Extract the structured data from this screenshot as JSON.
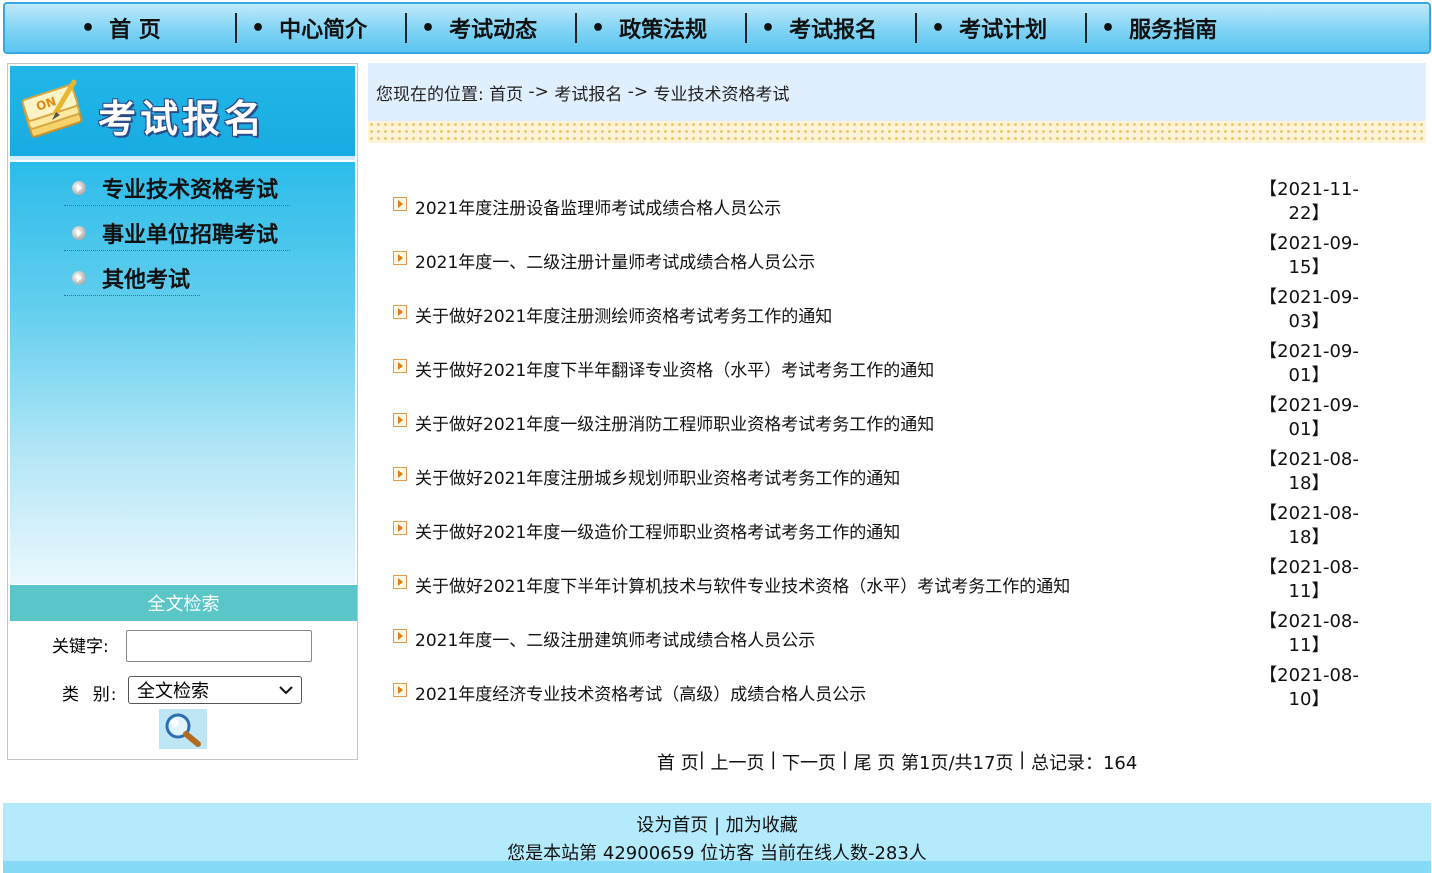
{
  "nav": {
    "items": [
      {
        "label": "首 页"
      },
      {
        "label": "中心简介"
      },
      {
        "label": "考试动态"
      },
      {
        "label": "政策法规"
      },
      {
        "label": "考试报名"
      },
      {
        "label": "考试计划"
      },
      {
        "label": "服务指南"
      }
    ],
    "bullet": "•"
  },
  "sidebar": {
    "banner_title": "考试报名",
    "items": [
      {
        "label": "专业技术资格考试"
      },
      {
        "label": "事业单位招聘考试"
      },
      {
        "label": "其他考试"
      }
    ],
    "search": {
      "heading": "全文检索",
      "keyword_label": "关键字:",
      "keyword_value": "",
      "category_label": "类  别:",
      "category_selected": "全文检索",
      "button_icon": "magnifier-icon"
    }
  },
  "breadcrumb": {
    "prefix": "您现在的位置: ",
    "home": "首页",
    "sep": " -> ",
    "section": "考试报名",
    "current": "专业技术资格考试"
  },
  "news": [
    {
      "title": "2021年度注册设备监理师考试成绩合格人员公示",
      "date": "【2021-11-22】"
    },
    {
      "title": "2021年度一、二级注册计量师考试成绩合格人员公示",
      "date": "【2021-09-15】"
    },
    {
      "title": "关于做好2021年度注册测绘师资格考试考务工作的通知",
      "date": "【2021-09-03】"
    },
    {
      "title": "关于做好2021年度下半年翻译专业资格（水平）考试考务工作的通知",
      "date": "【2021-09-01】"
    },
    {
      "title": "关于做好2021年度一级注册消防工程师职业资格考试考务工作的通知",
      "date": "【2021-09-01】"
    },
    {
      "title": "关于做好2021年度注册城乡规划师职业资格考试考务工作的通知",
      "date": "【2021-08-18】"
    },
    {
      "title": "关于做好2021年度一级造价工程师职业资格考试考务工作的通知",
      "date": "【2021-08-18】"
    },
    {
      "title": "关于做好2021年度下半年计算机技术与软件专业技术资格（水平）考试考务工作的通知",
      "date": "【2021-08-11】"
    },
    {
      "title": "2021年度一、二级注册建筑师考试成绩合格人员公示",
      "date": "【2021-08-11】"
    },
    {
      "title": "2021年度经济专业技术资格考试（高级）成绩合格人员公示",
      "date": "【2021-08-10】"
    }
  ],
  "pager": {
    "first": "首 页",
    "prev": "上一页",
    "next": "下一页",
    "last": "尾 页",
    "status": "第1页/共17页",
    "total": "总记录：164"
  },
  "footer": {
    "set_home": "设为首页",
    "favorite": "加为收藏",
    "counter": "您是本站第 42900659 位访客 当前在线人数-283人"
  },
  "colors": {
    "nav_bg": "#7fd3f5",
    "sidebar_banner": "#22b7e8",
    "search_head": "#5bc6c8",
    "crumb_bg": "#e0effd",
    "footer_bg": "#b3ebfc"
  }
}
